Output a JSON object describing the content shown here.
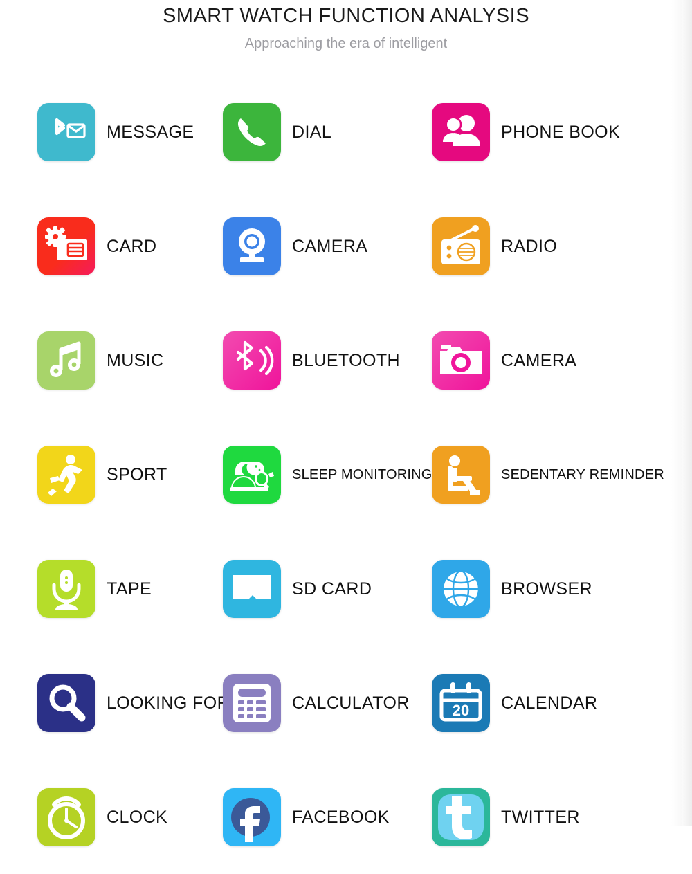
{
  "header": {
    "title": "SMART WATCH FUNCTION ANALYSIS",
    "subtitle": "Approaching the era of intelligent"
  },
  "colors": {
    "message": "#3fb9cd",
    "dial": "#3cb53c",
    "phone_book": "#e5097f",
    "card": "#f92c1c",
    "camera_video": "#3b82e8",
    "radio": "#f0a020",
    "music": "#a8d46a",
    "bluetooth": "#f0149b",
    "camera_photo": "#f0149b",
    "sport": "#f2d61a",
    "sleep": "#1fd93f",
    "sedentary": "#f0a020",
    "tape": "#b5dd2a",
    "sd_card": "#2fb6e0",
    "browser": "#2fa7e8",
    "looking_for": "#2b3087",
    "calculator": "#8a7fc0",
    "calendar": "#1b7ab5",
    "clock": "#b5d224",
    "facebook": "#2fb6f5",
    "twitter": "#2bb79a",
    "label_text": "#111111",
    "subtitle_text": "#9d9da2"
  },
  "rows": [
    [
      {
        "label": "MESSAGE",
        "icon": "bluetooth-message-icon",
        "small": false
      },
      {
        "label": "DIAL",
        "icon": "phone-handset-icon",
        "small": false
      },
      {
        "label": "PHONE BOOK",
        "icon": "contacts-people-icon",
        "small": false
      }
    ],
    [
      {
        "label": "CARD",
        "icon": "gear-card-icon",
        "small": false
      },
      {
        "label": "CAMERA",
        "icon": "webcam-icon",
        "small": false
      },
      {
        "label": "RADIO",
        "icon": "radio-icon",
        "small": false
      }
    ],
    [
      {
        "label": "MUSIC",
        "icon": "music-note-icon",
        "small": false
      },
      {
        "label": "BLUETOOTH",
        "icon": "bluetooth-wave-icon",
        "small": false
      },
      {
        "label": "CAMERA",
        "icon": "photo-camera-icon",
        "small": false
      }
    ],
    [
      {
        "label": "SPORT",
        "icon": "running-person-icon",
        "small": false
      },
      {
        "label": "SLEEP MONITORING",
        "icon": "sleeping-moon-icon",
        "small": true
      },
      {
        "label": "SEDENTARY REMINDER",
        "icon": "seated-person-icon",
        "small": true
      }
    ],
    [
      {
        "label": "TAPE",
        "icon": "microphone-icon",
        "small": false
      },
      {
        "label": "SD CARD",
        "icon": "sd-card-icon",
        "small": false
      },
      {
        "label": "BROWSER",
        "icon": "globe-icon",
        "small": false
      }
    ],
    [
      {
        "label": "LOOKING FOR",
        "icon": "magnifier-icon",
        "small": false
      },
      {
        "label": "CALCULATOR",
        "icon": "calculator-icon",
        "small": false
      },
      {
        "label": "CALENDAR",
        "icon": "calendar-icon",
        "small": false
      }
    ],
    [
      {
        "label": "CLOCK",
        "icon": "alarm-clock-icon",
        "small": false
      },
      {
        "label": "FACEBOOK",
        "icon": "facebook-f-icon",
        "small": false
      },
      {
        "label": "TWITTER",
        "icon": "twitter-bird-icon",
        "small": false
      }
    ]
  ],
  "calendar_day": "20"
}
